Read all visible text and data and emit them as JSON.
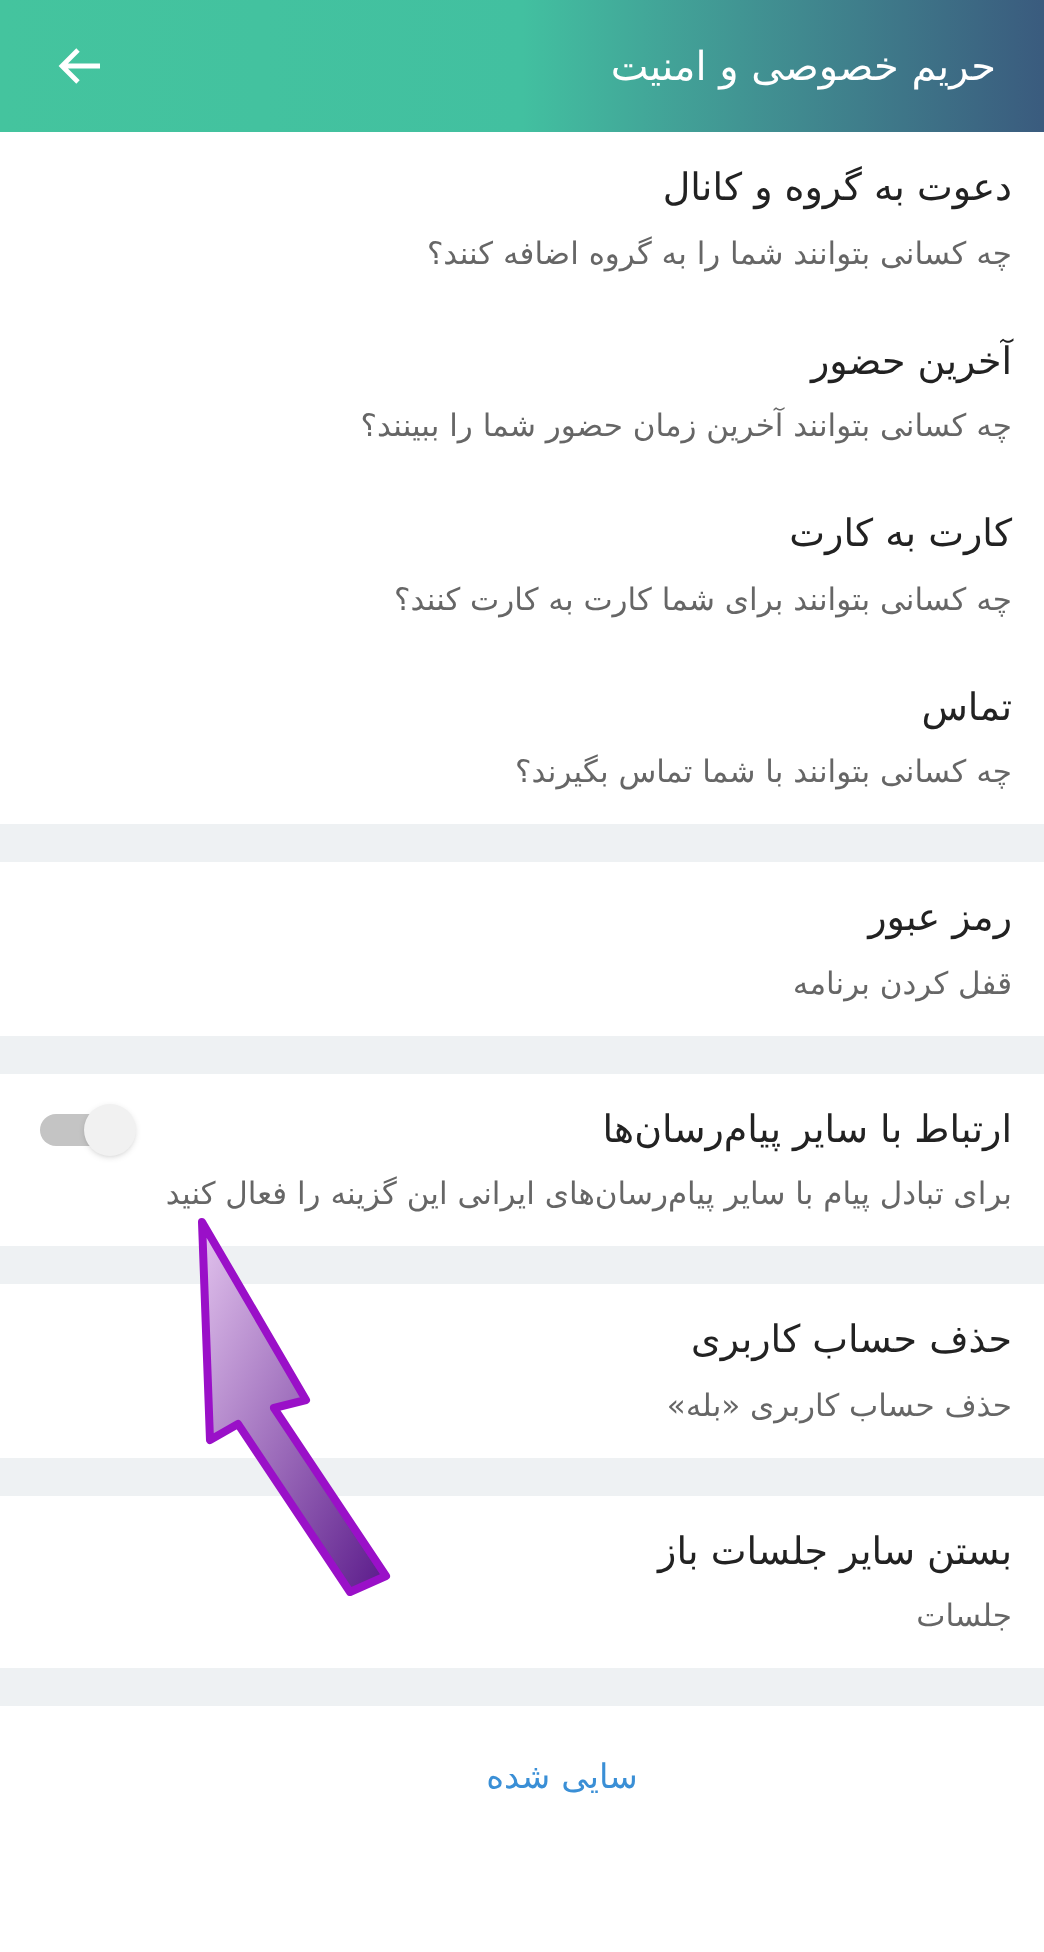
{
  "header": {
    "title": "حریم خصوصی و امنیت"
  },
  "groups": [
    {
      "items": [
        {
          "kind": "plain",
          "title": "دعوت به گروه و کانال",
          "subtitle": "چه کسانی بتوانند شما را به گروه اضافه کنند؟"
        },
        {
          "kind": "plain",
          "title": "آخرین حضور",
          "subtitle": "چه کسانی بتوانند آخرین زمان حضور شما را ببینند؟"
        },
        {
          "kind": "plain",
          "title": "کارت به کارت",
          "subtitle": "چه کسانی بتوانند برای شما کارت به کارت کنند؟"
        },
        {
          "kind": "plain",
          "title": "تماس",
          "subtitle": "چه کسانی بتوانند با شما تماس بگیرند؟"
        }
      ]
    },
    {
      "items": [
        {
          "kind": "plain",
          "title": "رمز عبور",
          "subtitle": "قفل کردن برنامه"
        }
      ]
    },
    {
      "items": [
        {
          "kind": "toggle",
          "title": "ارتباط با سایر پیام‌رسان‌ها",
          "subtitle": "برای تبادل پیام با سایر پیام‌رسان‌های ایرانی این گزینه را فعال کنید",
          "on": false
        }
      ]
    },
    {
      "items": [
        {
          "kind": "plain",
          "title": "حذف حساب کاربری",
          "subtitle": "حذف حساب کاربری «بله»"
        }
      ]
    },
    {
      "items": [
        {
          "kind": "plain",
          "title": "بستن سایر جلسات باز",
          "subtitle": "جلسات"
        }
      ]
    }
  ],
  "link": "سایی شده"
}
